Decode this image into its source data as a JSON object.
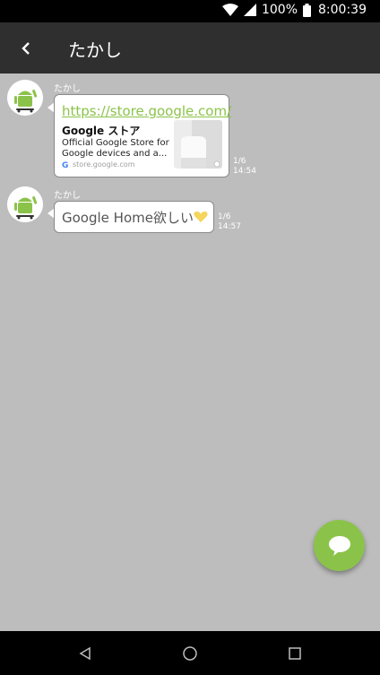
{
  "status_bar": {
    "battery": "100%",
    "time": "8:00:39",
    "icons": [
      "wifi-icon",
      "signal-icon",
      "battery-icon"
    ]
  },
  "header": {
    "title": "たかし",
    "back_icon": "back-arrow-icon"
  },
  "messages": [
    {
      "sender": "たかし",
      "type": "link_preview",
      "link": "https://store.google.com/",
      "card_title": "Google ストア",
      "card_description": "Official Google Store for Google devices and a...",
      "card_domain": "store.google.com",
      "read": "1/6",
      "time": "14:54"
    },
    {
      "sender": "たかし",
      "type": "text",
      "text": "Google Home欲しい",
      "read": "1/6",
      "time": "14:57"
    }
  ],
  "fab": {
    "icon": "chat-icon"
  },
  "nav": {
    "icons": [
      "back-icon",
      "home-icon",
      "recents-icon"
    ]
  },
  "colors": {
    "accent": "#8bc34a",
    "background": "#bdbdbd",
    "app_bar": "#2f2f2f"
  }
}
